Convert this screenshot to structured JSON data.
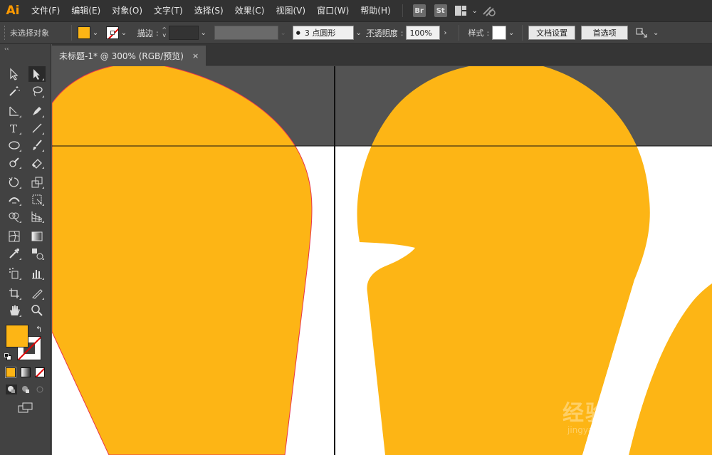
{
  "app": {
    "logo": "Ai"
  },
  "menu": {
    "items": [
      "文件(F)",
      "编辑(E)",
      "对象(O)",
      "文字(T)",
      "选择(S)",
      "效果(C)",
      "视图(V)",
      "窗口(W)",
      "帮助(H)"
    ],
    "bridge_badge": "Br",
    "stock_badge": "St"
  },
  "control_bar": {
    "selection_status": "未选择对象",
    "fill_color": "#fdb515",
    "stroke_color": "none",
    "stroke_label": "描边",
    "brush_value": "3 点圆形",
    "opacity_label": "不透明度",
    "opacity_value": "100%",
    "style_label": "样式",
    "doc_setup_button": "文档设置",
    "prefs_button": "首选项"
  },
  "document": {
    "tab_title": "未标题-1* @ 300% (RGB/预览)",
    "close_glyph": "×",
    "artwork_color": "#fdb515",
    "artboard_color": "#ffffff",
    "pasteboard_color": "#535353"
  },
  "tools": {
    "rows": [
      [
        "selection-tool",
        "direct-selection-tool"
      ],
      [
        "magic-wand-tool",
        "lasso-tool"
      ],
      [
        "pen-tool",
        "curvature-tool"
      ],
      [
        "type-tool",
        "line-segment-tool"
      ],
      [
        "ellipse-tool",
        "paintbrush-tool"
      ],
      [
        "shaper-tool",
        "eraser-tool"
      ],
      [
        "rotate-tool",
        "scale-tool"
      ],
      [
        "width-tool",
        "free-transform-tool"
      ],
      [
        "shape-builder-tool",
        "perspective-grid-tool"
      ],
      [
        "mesh-tool",
        "gradient-tool"
      ],
      [
        "eyedropper-tool",
        "blend-tool"
      ],
      [
        "symbol-sprayer-tool",
        "column-graph-tool"
      ],
      [
        "artboard-tool",
        "slice-tool"
      ],
      [
        "hand-tool",
        "zoom-tool"
      ]
    ],
    "fill_color": "#fdb515",
    "stroke_color": "none"
  },
  "watermark": {
    "text": "经验",
    "sub": "jingyan"
  }
}
